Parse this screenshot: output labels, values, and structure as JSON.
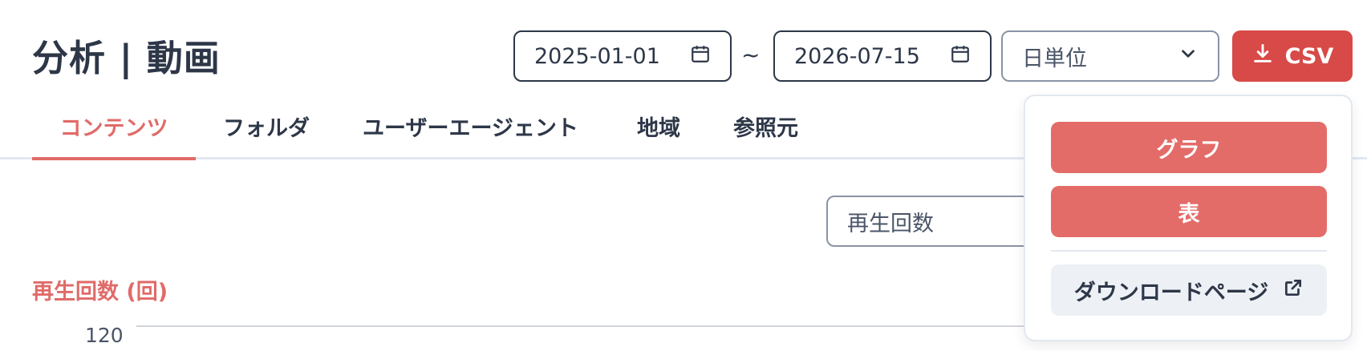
{
  "page": {
    "title": "分析 | 動画"
  },
  "filters": {
    "start_date": "2025-01-01",
    "separator": "~",
    "end_date": "2026-07-15",
    "granularity": "日単位",
    "csv_label": "CSV"
  },
  "tabs": [
    {
      "label": "コンテンツ",
      "active": true
    },
    {
      "label": "フォルダ",
      "active": false
    },
    {
      "label": "ユーザーエージェント",
      "active": false
    },
    {
      "label": "地域",
      "active": false
    },
    {
      "label": "参照元",
      "active": false
    }
  ],
  "metric_select": {
    "value": "再生回数"
  },
  "chart": {
    "title": "再生回数 (回)",
    "y_ticks": [
      "120"
    ]
  },
  "csv_menu": {
    "graph_label": "グラフ",
    "table_label": "表",
    "download_page_label": "ダウンロードページ"
  },
  "colors": {
    "accent": "#e06b68",
    "primary_button": "#d74a47",
    "text": "#2d3748"
  },
  "icons": {
    "date": "calendar-icon",
    "select": "chevron-down-icon",
    "csv": "download-icon",
    "external": "external-link-icon"
  }
}
